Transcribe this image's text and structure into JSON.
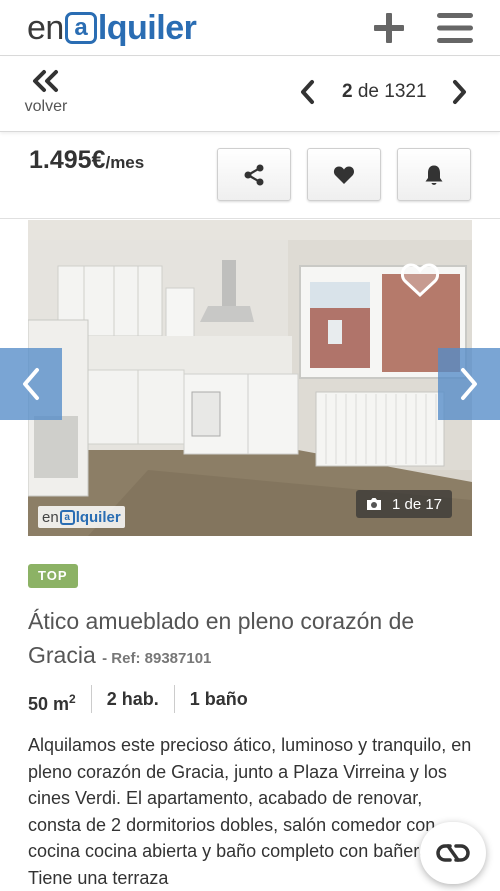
{
  "header": {
    "logo_en": "en",
    "logo_at": "a",
    "logo_alquiler": "lquiler",
    "icons": [
      "plus-icon",
      "menu-icon"
    ]
  },
  "nav": {
    "back_label": "volver",
    "current": "2",
    "of_label": "de",
    "total": "1321"
  },
  "listing": {
    "price": "1.495€",
    "price_unit": "/mes",
    "actions": [
      "share-icon",
      "heart-icon",
      "bell-icon"
    ],
    "photo_counter": "1 de 17",
    "watermark": {
      "en": "en",
      "at": "a",
      "alq": "lquiler"
    },
    "badge": "TOP",
    "title": "Ático amueblado en pleno corazón de Gracia",
    "ref": "- Ref: 89387101",
    "features": {
      "area": "50 m",
      "area_sup": "2",
      "rooms": "2 hab.",
      "baths": "1 baño"
    },
    "description": "Alquilamos este precioso ático, luminoso y tranquilo, en pleno corazón de Gracia, junto a Plaza Virreina y los cines Verdi. El apartamento, acabado de renovar, consta de 2 dormitorios dobles, salón comedor con cocina cocina abierta y baño completo con bañera. Tiene una terraza"
  },
  "colors": {
    "brand_blue": "#2a6db3",
    "badge_green": "#8cb265",
    "photo_arrow": "#548cc8"
  }
}
